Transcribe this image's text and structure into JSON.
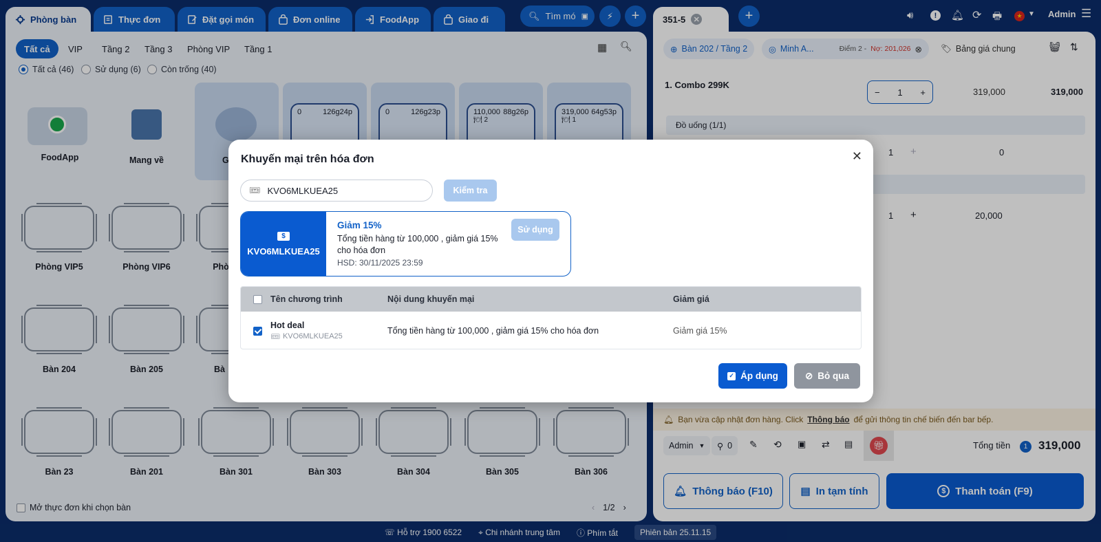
{
  "top_tabs": [
    "Phòng bàn",
    "Thực đơn",
    "Đặt gọi món",
    "Đơn online",
    "FoodApp",
    "Giao đi"
  ],
  "search_placeholder": "Tìm mó",
  "floor_filters": [
    "Tất cả",
    "VIP",
    "Tầng 2",
    "Tầng 3",
    "Phòng VIP",
    "Tầng 1"
  ],
  "status_filters": [
    "Tất cả (46)",
    "Sử dụng (6)",
    "Còn trống (40)"
  ],
  "cards_row1": {
    "foodapp": "FoodApp",
    "mangve": "Mang về",
    "partial": "G",
    "t1": {
      "left": "0",
      "right": "126g24p"
    },
    "t2": {
      "left": "0",
      "right": "126g23p"
    },
    "t3": {
      "left": "110,000",
      "right": "88g26p",
      "sub": "🍽 2"
    },
    "t4": {
      "left": "319,000",
      "right": "64g53p",
      "sub": "🍽 1"
    }
  },
  "row2_titles": [
    "Phòng VIP5",
    "Phòng VIP6",
    "Phò"
  ],
  "row3_titles": [
    "Bàn 204",
    "Bàn 205",
    "Bà"
  ],
  "row4_titles": [
    "Bàn 23",
    "Bàn 201",
    "Bàn 301",
    "Bàn 303",
    "Bàn 304",
    "Bàn 305",
    "Bàn 306"
  ],
  "open_menu_label": "Mở thực đơn khi chọn bàn",
  "pagination": "1/2",
  "right": {
    "order_tab": "351-5",
    "admin": "Admin",
    "table_label": "Bàn 202 / Tầng 2",
    "customer": "Minh A...",
    "points": "Điểm 2 - ",
    "debt": "Nợ: 201,026",
    "price_list": "Bảng giá chung",
    "item1": {
      "name": "1. Combo 299K",
      "qty": "1",
      "price": "319,000",
      "total": "319,000"
    },
    "group": "Đồ uống (1/1)",
    "item2": {
      "qty": "1",
      "price": "0"
    },
    "item3": {
      "qty": "1",
      "price": "20,000"
    },
    "notice_prefix": "Bạn vừa cập nhật đơn hàng. Click ",
    "notice_link": "Thông báo",
    "notice_suffix": " để gửi thông tin chế biến đến bar bếp.",
    "staff": "Admin",
    "count": "0",
    "total_label": "Tổng tiền",
    "total_badge": "1",
    "total_value": "319,000",
    "btn_notify": "Thông báo (F10)",
    "btn_print": "In tạm tính",
    "btn_pay": "Thanh toán (F9)"
  },
  "footer": {
    "support": "Hỗ trợ 1900 6522",
    "branch": "Chi nhánh trung tâm",
    "shortcut": "Phím tắt",
    "version": "Phiên bản 25.11.15"
  },
  "modal": {
    "title": "Khuyến mại trên hóa đơn",
    "code_value": "KVO6MLKUEA25",
    "check_label": "Kiểm tra",
    "voucher": {
      "code": "KVO6MLKUEA25",
      "name": "Giảm 15%",
      "desc": "Tổng tiền hàng từ 100,000 , giảm giá 15% cho hóa đơn",
      "expiry": "HSD: 30/11/2025 23:59",
      "use_label": "Sử dụng"
    },
    "columns": [
      "Tên chương trình",
      "Nội dung khuyến mại",
      "Giảm giá"
    ],
    "row": {
      "name": "Hot deal",
      "code": "KVO6MLKUEA25",
      "content": "Tổng tiền hàng từ 100,000 , giảm giá 15% cho hóa đơn",
      "discount": "Giảm giá 15%"
    },
    "apply_label": "Áp dụng",
    "skip_label": "Bỏ qua"
  },
  "colors": {
    "primary": "#1262c8",
    "dark": "#0b2d6b",
    "danger": "#e0494f"
  }
}
